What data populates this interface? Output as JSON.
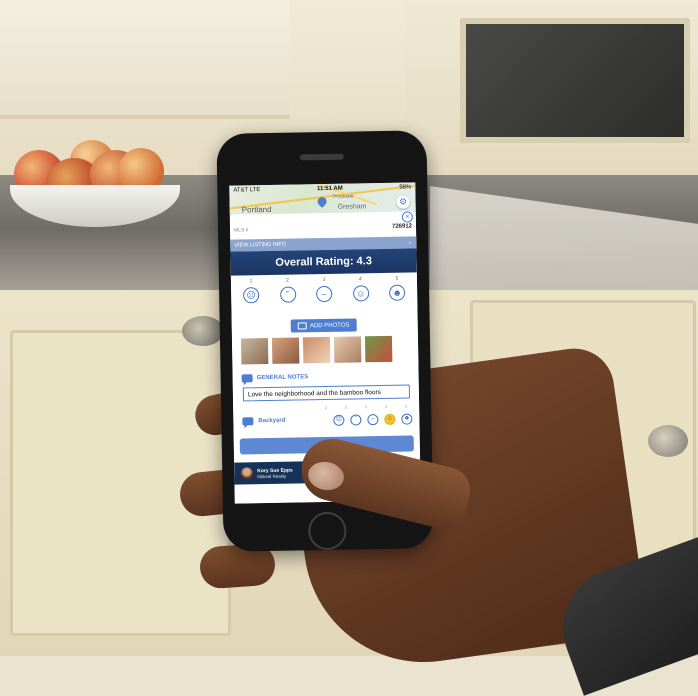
{
  "status_bar": {
    "carrier": "AT&T LTE",
    "time": "11:51 AM",
    "battery": "98%"
  },
  "map": {
    "labels": [
      "Portland",
      "Gresham",
      "Troutdale"
    ]
  },
  "sheet": {
    "mls_label": "MLS #",
    "mls_value": "726912",
    "view_listing_label": "VIEW LISTING INFO",
    "overall_rating": "Overall Rating: 4.3",
    "rating_scale": [
      "1",
      "2",
      "3",
      "4",
      "5"
    ],
    "add_photos_label": "ADD PHOTOS",
    "general_notes_label": "GENERAL NOTES",
    "notes_text": "Love the neighborhood and the bamboo floors",
    "category_scale": [
      "1",
      "2",
      "3",
      "4",
      "5"
    ],
    "category_label": "Backyard",
    "category_selected_rating": 4
  },
  "agent": {
    "name": "Kory Sue Epps",
    "company": "Nbkeal Reality"
  },
  "colors": {
    "accent": "#4d7ed1",
    "header": "#1a3563",
    "selected": "#f1c430"
  },
  "icons": [
    "settings-icon",
    "close-icon",
    "chevron-down-icon",
    "camera-icon",
    "chat-icon",
    "smiley-icon"
  ]
}
